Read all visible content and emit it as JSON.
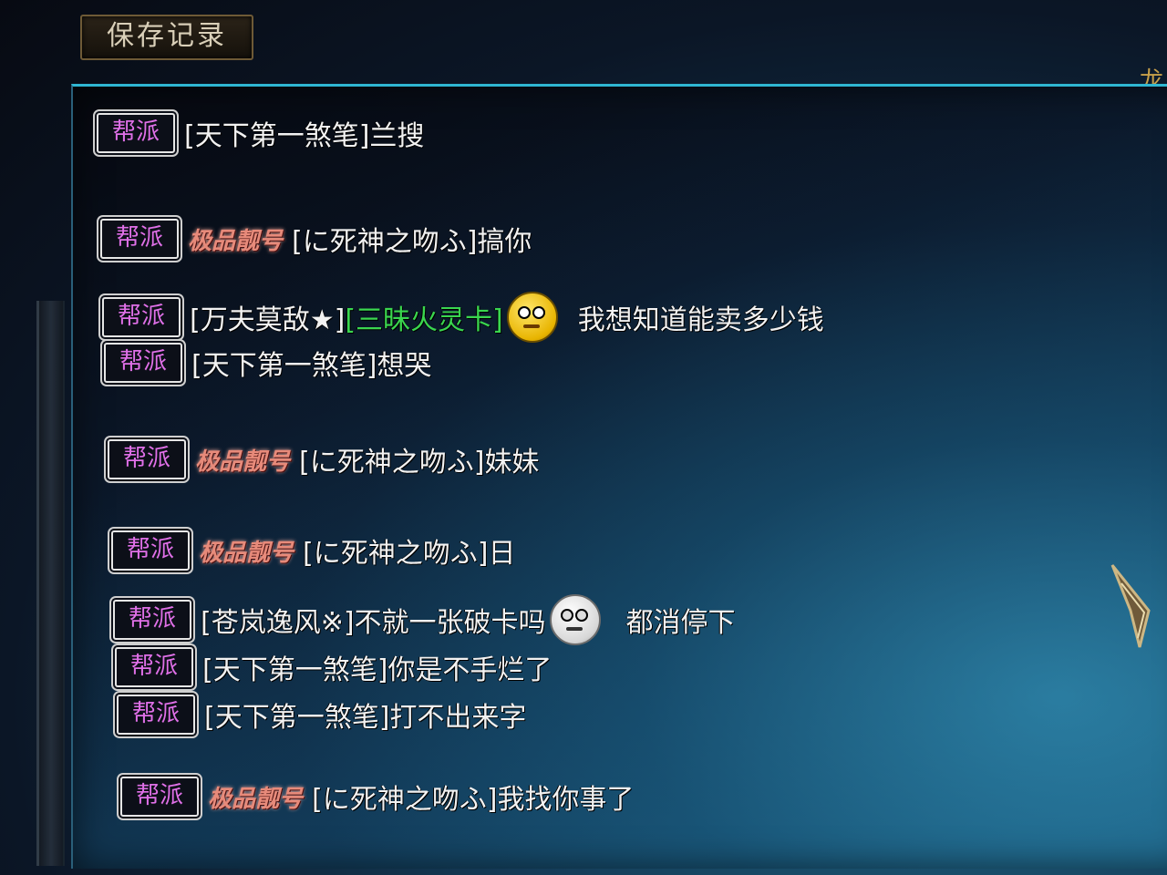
{
  "window": {
    "title": "保存记录",
    "corner_glyph": "龙"
  },
  "channel_badge": "帮派",
  "messages": [
    {
      "sender": "[天下第一煞笔]",
      "text": "兰搜"
    },
    {
      "title": "极品靓号",
      "sender": "[に死神之吻ふ]",
      "text": "搞你"
    },
    {
      "sender": "[万夫莫敌★]",
      "item": "[三昧火灵卡]",
      "emoji": "confused-face-emoji",
      "text": "我想知道能卖多少钱"
    },
    {
      "sender": "[天下第一煞笔]",
      "text": "想哭"
    },
    {
      "title": "极品靓号",
      "sender": "[に死神之吻ふ]",
      "text": "妹妹"
    },
    {
      "title": "极品靓号",
      "sender": "[に死神之吻ふ]",
      "text": "日"
    },
    {
      "sender": "[苍岚逸风※]",
      "text": "不就一张破卡吗",
      "emoji": "speechless-face-emoji",
      "after": "都消停下"
    },
    {
      "sender": "[天下第一煞笔]",
      "text": "你是不手烂了"
    },
    {
      "sender": "[天下第一煞笔]",
      "text": "打不出来字"
    },
    {
      "title": "极品靓号",
      "sender": "[に死神之吻ふ]",
      "text": "我找你事了"
    }
  ],
  "colors": {
    "badge_text": "#e070e8",
    "item_text": "#3ad64f",
    "panel_border": "#2fb6d2",
    "fancy_title": "#e78a7a"
  }
}
